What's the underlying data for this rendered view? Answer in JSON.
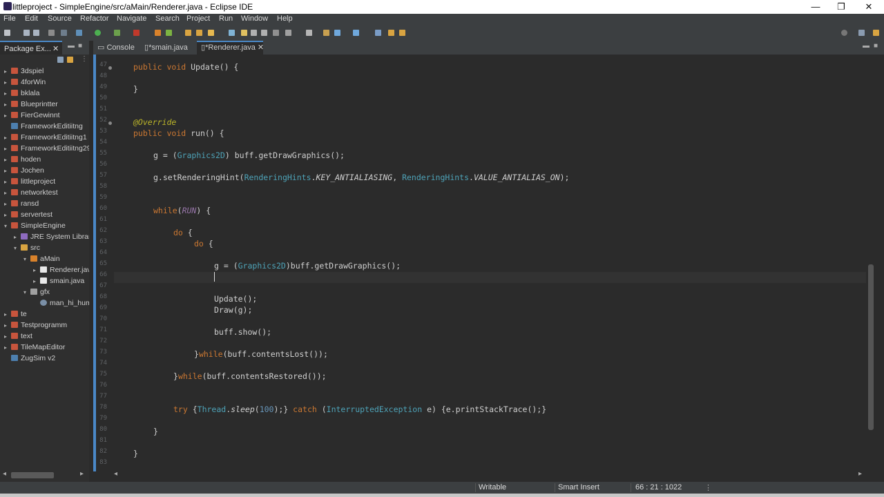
{
  "window": {
    "title": "littleproject - SimpleEngine/src/aMain/Renderer.java - Eclipse IDE",
    "controls": [
      "—",
      "❐",
      "✕"
    ]
  },
  "menu": [
    "File",
    "Edit",
    "Source",
    "Refactor",
    "Navigate",
    "Search",
    "Project",
    "Run",
    "Window",
    "Help"
  ],
  "package_explorer": {
    "tab_label": "Package Ex...",
    "close": "✕",
    "items": [
      {
        "label": "3dspiel",
        "arrow": "▸"
      },
      {
        "label": "4forWin",
        "arrow": "▸"
      },
      {
        "label": "bklala",
        "arrow": "▸"
      },
      {
        "label": "Blueprintter",
        "arrow": "▸"
      },
      {
        "label": "FierGewinnt",
        "arrow": "▸"
      },
      {
        "label": "FrameworkEditiitng",
        "arrow": ""
      },
      {
        "label": "FrameworkEditiitng1",
        "arrow": "▸"
      },
      {
        "label": "FrameworkEditiitng29",
        "arrow": "▸"
      },
      {
        "label": "hoden",
        "arrow": "▸"
      },
      {
        "label": "Jochen",
        "arrow": "▸"
      },
      {
        "label": "littleproject",
        "arrow": "▸"
      },
      {
        "label": "networktest",
        "arrow": "▸"
      },
      {
        "label": "ransd",
        "arrow": "▸"
      },
      {
        "label": "servertest",
        "arrow": "▸"
      },
      {
        "label": "SimpleEngine",
        "arrow": "▾"
      },
      {
        "label": "JRE System Library",
        "arrow": "▸"
      },
      {
        "label": "src",
        "arrow": "▾"
      },
      {
        "label": "aMain",
        "arrow": "▾"
      },
      {
        "label": "Renderer.jav",
        "arrow": "▸"
      },
      {
        "label": "smain.java",
        "arrow": "▸"
      },
      {
        "label": "gfx",
        "arrow": "▾"
      },
      {
        "label": "man_hi_hum",
        "arrow": ""
      },
      {
        "label": "te",
        "arrow": "▸"
      },
      {
        "label": "Testprogramm",
        "arrow": "▸"
      },
      {
        "label": "text",
        "arrow": "▸"
      },
      {
        "label": "TileMapEditor",
        "arrow": "▸"
      },
      {
        "label": "ZugSim v2",
        "arrow": ""
      }
    ]
  },
  "editor_tabs": [
    {
      "label": "Console",
      "icon": "console-icon"
    },
    {
      "label": "*smain.java",
      "icon": "java-file-icon"
    },
    {
      "label": "*Renderer.java",
      "icon": "java-file-icon",
      "close": "✕"
    }
  ],
  "line_numbers": [
    "47",
    "48",
    "49",
    "50",
    "51",
    "52",
    "53",
    "54",
    "55",
    "56",
    "57",
    "58",
    "59",
    "60",
    "61",
    "62",
    "63",
    "64",
    "65",
    "66",
    "67",
    "68",
    "69",
    "70",
    "71",
    "72",
    "73",
    "74",
    "75",
    "76",
    "77",
    "78",
    "79",
    "80",
    "81",
    "82",
    "83"
  ],
  "code": {
    "l_update_sig": [
      "public",
      " ",
      "void",
      " Update() {"
    ],
    "l_close1": "}",
    "l_override": "@Override",
    "l_run_sig": [
      "public",
      " ",
      "void",
      " run() {"
    ],
    "l_g_assign": [
      "g = (",
      "Graphics2D",
      ") buff.getDrawGraphics();"
    ],
    "l_hint": [
      "g.setRenderingHint(",
      "RenderingHints",
      ".",
      "KEY_ANTIALIASING",
      ", ",
      "RenderingHints",
      ".",
      "VALUE_ANTIALIAS_ON",
      ");"
    ],
    "l_while": [
      "while",
      "(",
      "RUN",
      ") {"
    ],
    "l_do1": [
      "do",
      " {"
    ],
    "l_do2": [
      "do",
      " {"
    ],
    "l_g2": [
      "g = (",
      "Graphics2D",
      ")buff.getDrawGraphics();"
    ],
    "l_update_call": "Update();",
    "l_draw": "Draw(g);",
    "l_show": "buff.show();",
    "l_while_lost": [
      "}",
      "while",
      "(buff.contentsLost());"
    ],
    "l_while_restored": [
      "}",
      "while",
      "(buff.contentsRestored());"
    ],
    "l_try": [
      "try",
      " {",
      "Thread",
      ".",
      "sleep",
      "(",
      "100",
      ");} ",
      "catch",
      " (",
      "InterruptedException",
      " e) {e.printStackTrace();}"
    ],
    "l_close2": "}",
    "l_close3": "}"
  },
  "status": {
    "writable": "Writable",
    "insert_mode": "Smart Insert",
    "position": "66 : 21 : 1022"
  }
}
